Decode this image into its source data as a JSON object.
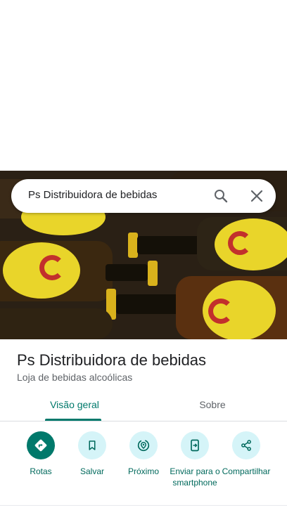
{
  "search": {
    "query": "Ps Distribuidora de bebidas"
  },
  "place": {
    "title": "Ps Distribuidora de bebidas",
    "category": "Loja de bebidas alcoólicas"
  },
  "tabs": [
    {
      "label": "Visão geral",
      "selected": true
    },
    {
      "label": "Sobre",
      "selected": false
    }
  ],
  "actions": [
    {
      "label": "Rotas",
      "icon": "directions-icon"
    },
    {
      "label": "Salvar",
      "icon": "bookmark-icon"
    },
    {
      "label": "Próximo",
      "icon": "nearby-icon"
    },
    {
      "label": "Enviar para o smartphone",
      "icon": "send-to-phone-icon"
    },
    {
      "label": "Compartilhar",
      "icon": "share-icon"
    }
  ],
  "colors": {
    "accent": "#00796b",
    "action_bg": "#d5f4f8",
    "bottle_label": "#e9d52a",
    "logo_red": "#c2302c"
  }
}
